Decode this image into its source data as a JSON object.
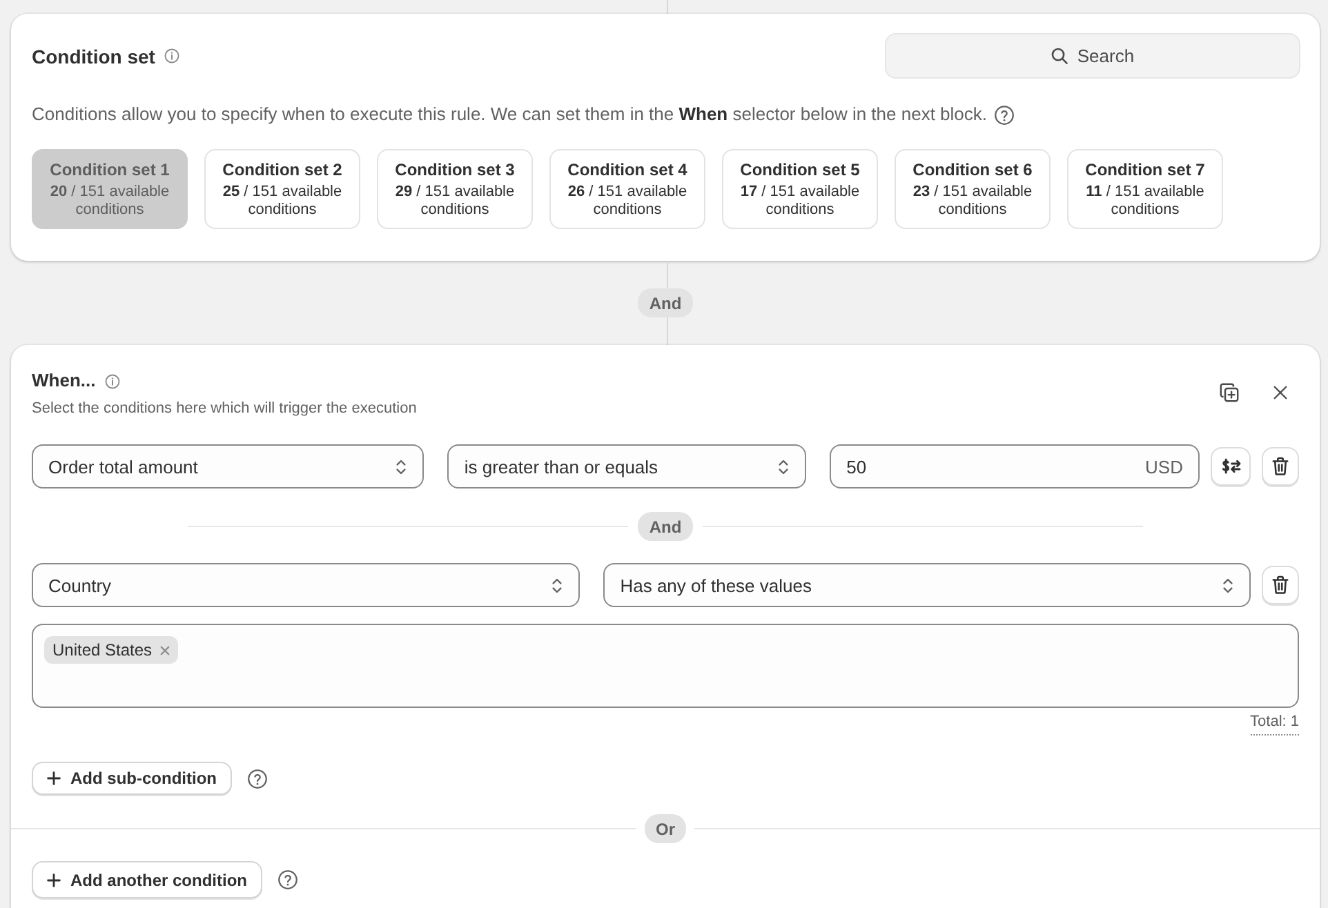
{
  "condition_set": {
    "title": "Condition set",
    "search": {
      "label": "Search"
    },
    "description": "Conditions allow you to specify when to execute this rule. We can set them in the **When** selector below in the next block.",
    "sets": [
      {
        "name": "Condition set 1",
        "count": "**20** / 151 available conditions",
        "selected": true
      },
      {
        "name": "Condition set 2",
        "count": "**25** / 151 available conditions",
        "selected": false
      },
      {
        "name": "Condition set 3",
        "count": "**29** / 151 available conditions",
        "selected": false
      },
      {
        "name": "Condition set 4",
        "count": "**26** / 151 available conditions",
        "selected": false
      },
      {
        "name": "Condition set 5",
        "count": "**17** / 151 available conditions",
        "selected": false
      },
      {
        "name": "Condition set 6",
        "count": "**23** / 151 available conditions",
        "selected": false
      },
      {
        "name": "Condition set 7",
        "count": "**11** / 151 available conditions",
        "selected": false
      }
    ]
  },
  "connector": "And",
  "when": {
    "title": "When...",
    "subtitle": "Select the conditions here which will trigger the execution",
    "conditions": [
      {
        "kind": "amount",
        "field": "Order total amount",
        "operator": "is greater than or equals",
        "value": "50",
        "unit": "USD"
      },
      {
        "kind": "values",
        "joiner": "And",
        "field": "Country",
        "operator": "Has any of these values",
        "tags": [
          "United States"
        ],
        "total": "Total: 1"
      }
    ],
    "add_sub_condition": "Add sub-condition",
    "separator": "Or",
    "add_another_condition": "Add another condition"
  }
}
